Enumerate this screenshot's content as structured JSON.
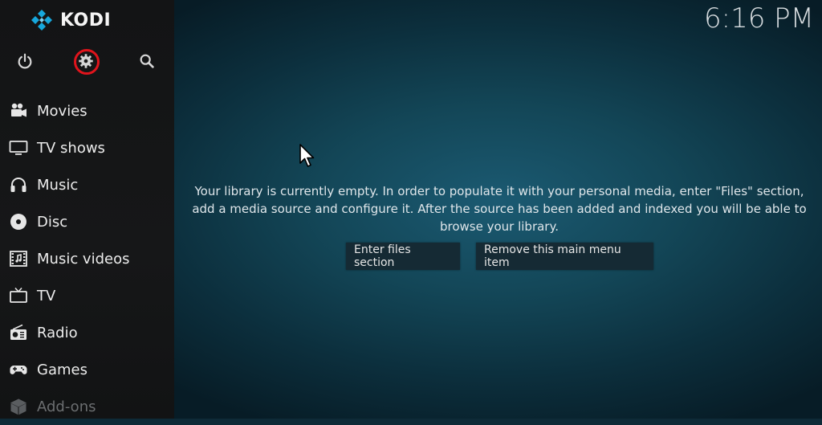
{
  "app": {
    "brand": "KODI",
    "accent": "#17a7dc",
    "highlight_ring": "#e0141c"
  },
  "clock": {
    "time": "6:16 PM"
  },
  "top_icons": [
    {
      "name": "power-icon"
    },
    {
      "name": "settings-gear-icon"
    },
    {
      "name": "search-icon"
    }
  ],
  "sidebar": {
    "items": [
      {
        "label": "Movies",
        "icon": "movie-camera-icon"
      },
      {
        "label": "TV shows",
        "icon": "monitor-icon"
      },
      {
        "label": "Music",
        "icon": "headphones-icon"
      },
      {
        "label": "Disc",
        "icon": "disc-icon"
      },
      {
        "label": "Music videos",
        "icon": "film-strip-icon"
      },
      {
        "label": "TV",
        "icon": "tv-icon"
      },
      {
        "label": "Radio",
        "icon": "radio-icon"
      },
      {
        "label": "Games",
        "icon": "gamepad-icon"
      },
      {
        "label": "Add-ons",
        "icon": "box-icon"
      }
    ]
  },
  "main": {
    "message": "Your library is currently empty. In order to populate it with your personal media, enter \"Files\" section, add a media source and configure it. After the source has been added and indexed you will be able to browse your library.",
    "buttons": {
      "enter_files": "Enter files section",
      "remove_item": "Remove this main menu item"
    }
  }
}
